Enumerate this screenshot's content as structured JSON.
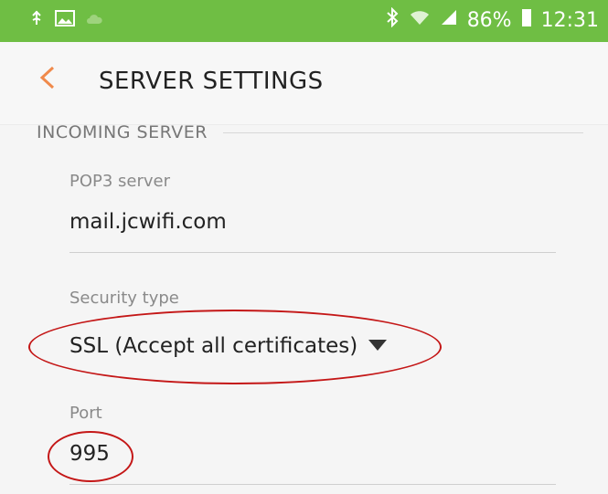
{
  "status_bar": {
    "battery_percent": "86%",
    "time": "12:31",
    "icons_left": [
      "usb-icon",
      "image-icon",
      "cloud-icon"
    ],
    "icons_right": [
      "bluetooth-icon",
      "wifi-icon",
      "signal-icon",
      "battery-icon"
    ]
  },
  "app_bar": {
    "title": "SERVER SETTINGS"
  },
  "section": {
    "title": "INCOMING SERVER"
  },
  "fields": {
    "server": {
      "label": "POP3 server",
      "value": "mail.jcwifi.com"
    },
    "security": {
      "label": "Security type",
      "value": "SSL (Accept all certificates)"
    },
    "port": {
      "label": "Port",
      "value": "995"
    }
  },
  "colors": {
    "status_bar": "#6fbe44",
    "accent": "#f08a4b",
    "annotation": "#c41717"
  }
}
